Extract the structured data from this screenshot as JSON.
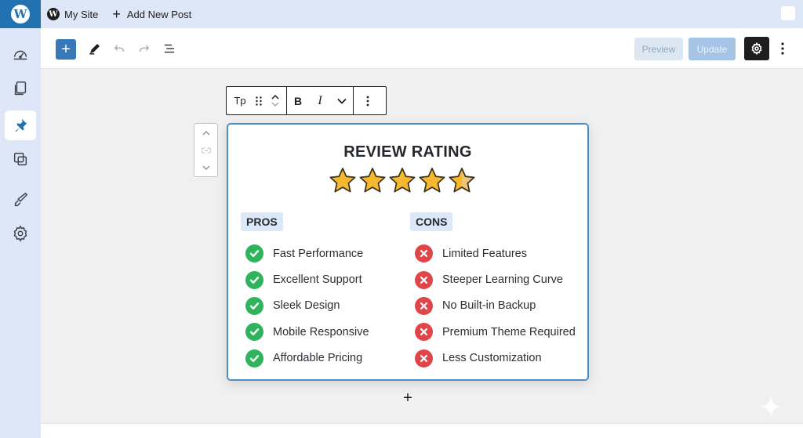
{
  "adminbar": {
    "logo_icon": "wordpress-logo-icon",
    "site_name": "My Site",
    "new_post_label": "Add New Post"
  },
  "rail": {
    "items": [
      {
        "name": "dashboard",
        "icon": "dashboard-icon",
        "active": false
      },
      {
        "name": "pages",
        "icon": "pages-icon",
        "active": false
      },
      {
        "name": "posts",
        "icon": "pin-icon",
        "active": true
      },
      {
        "name": "media",
        "icon": "media-icon",
        "active": false
      },
      {
        "name": "appearance",
        "icon": "brush-icon",
        "active": false
      },
      {
        "name": "settings",
        "icon": "gear-icon",
        "active": false
      }
    ]
  },
  "header": {
    "preview_label": "Preview",
    "update_label": "Update"
  },
  "block_toolbar": {
    "type_label": "Tp",
    "bold_label": "B",
    "italic_label": "I"
  },
  "review": {
    "title": "REVIEW RATING",
    "rating": 4.5,
    "rating_max": 5,
    "pros": {
      "label": "PROS",
      "items": [
        "Fast Performance",
        "Excellent Support",
        "Sleek Design",
        "Mobile Responsive",
        "Affordable Pricing"
      ]
    },
    "cons": {
      "label": "CONS",
      "items": [
        "Limited Features",
        "Steeper Learning Curve",
        "No Built-in Backup",
        "Premium Theme Required",
        "Less Customization"
      ]
    }
  },
  "colors": {
    "brand": "#2271b1",
    "accent_border": "#4a8fc7",
    "check": "#2fb35c",
    "cross": "#e0454a",
    "star": "#f5b82e"
  }
}
